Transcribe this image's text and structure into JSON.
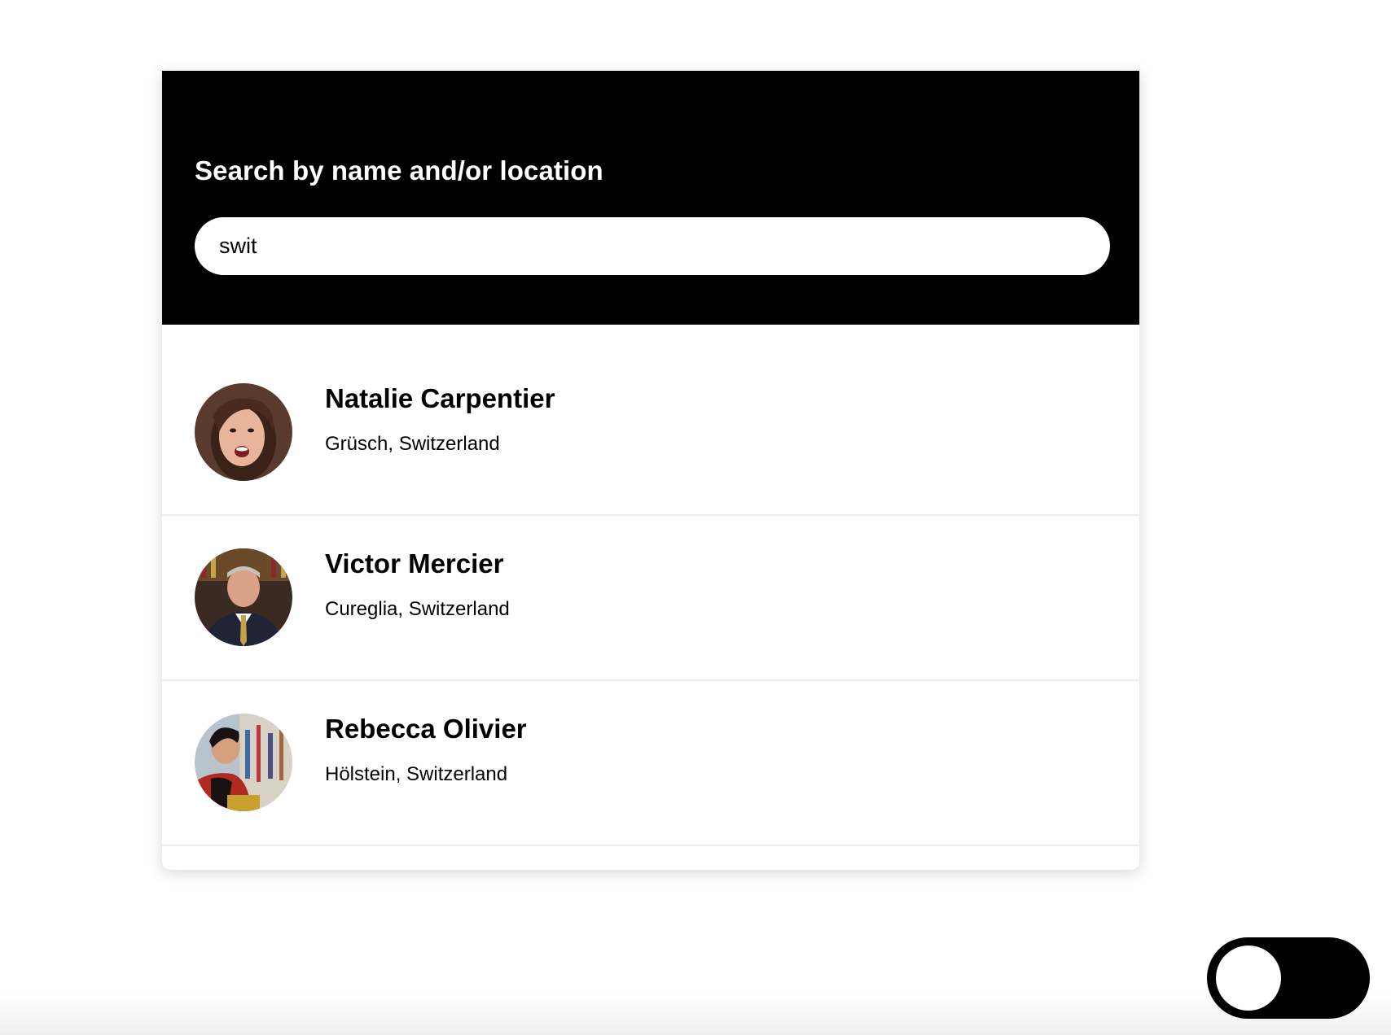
{
  "search": {
    "label": "Search by name and/or location",
    "value": "swit"
  },
  "results": [
    {
      "name": "Natalie Carpentier",
      "location": "Grüsch, Switzerland"
    },
    {
      "name": "Victor Mercier",
      "location": "Cureglia, Switzerland"
    },
    {
      "name": "Rebecca Olivier",
      "location": "Hölstein, Switzerland"
    }
  ],
  "theme_toggle": {
    "state": "off"
  },
  "colors": {
    "header_background": "#000000",
    "page_background": "#ffffff",
    "divider": "#ededed",
    "spellcheck_underline": "#e0402f"
  }
}
